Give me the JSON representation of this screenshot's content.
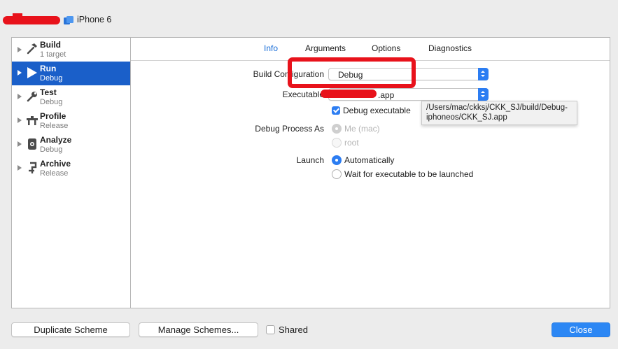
{
  "scheme_bar": {
    "device_name": "iPhone 6",
    "device_icon": "simulator-device-icon"
  },
  "sidebar": {
    "items": [
      {
        "name": "Build",
        "subtitle": "1 target",
        "icon": "hammer-icon",
        "selected": false
      },
      {
        "name": "Run",
        "subtitle": "Debug",
        "icon": "play-icon",
        "selected": true
      },
      {
        "name": "Test",
        "subtitle": "Debug",
        "icon": "wrench-icon",
        "selected": false
      },
      {
        "name": "Profile",
        "subtitle": "Release",
        "icon": "instruments-icon",
        "selected": false
      },
      {
        "name": "Analyze",
        "subtitle": "Debug",
        "icon": "analyze-icon",
        "selected": false
      },
      {
        "name": "Archive",
        "subtitle": "Release",
        "icon": "archive-icon",
        "selected": false
      }
    ]
  },
  "tabs": {
    "info": "Info",
    "arguments": "Arguments",
    "options": "Options",
    "diagnostics": "Diagnostics",
    "active": "Info"
  },
  "info": {
    "build_configuration_label": "Build Configuration",
    "build_configuration_value": "Debug",
    "executable_label": "Executable",
    "executable_value": ".app",
    "debug_executable_label": "Debug executable",
    "debug_executable_checked": true,
    "executable_tooltip": "/Users/mac/ckksj/CKK_SJ/build/Debug-iphoneos/CKK_SJ.app",
    "debug_process_as_label": "Debug Process As",
    "debug_process_as_options": [
      "Me (mac)",
      "root"
    ],
    "launch_label": "Launch",
    "launch_options": [
      "Automatically",
      "Wait for executable to be launched"
    ],
    "launch_selected": "Automatically"
  },
  "footer": {
    "duplicate_scheme": "Duplicate Scheme",
    "manage_schemes": "Manage Schemes...",
    "shared_label": "Shared",
    "shared_checked": false,
    "close": "Close"
  },
  "colors": {
    "accent": "#2c7df2",
    "selection": "#1a5fc9",
    "annotation_red": "#e8121b"
  }
}
